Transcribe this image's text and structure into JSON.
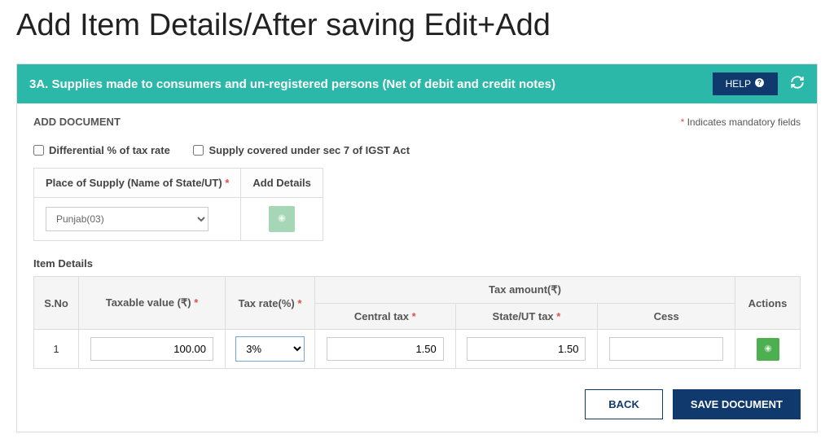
{
  "page": {
    "title": "Add Item Details/After saving Edit+Add"
  },
  "section": {
    "header": "3A. Supplies made to consumers and un-registered persons (Net of debit and credit notes)",
    "help_label": "HELP"
  },
  "doc": {
    "add_label": "ADD DOCUMENT",
    "mandatory_note": "Indicates mandatory fields",
    "checkbox1": "Differential % of tax rate",
    "checkbox2": "Supply covered under sec 7 of IGST Act",
    "pos_header": "Place of Supply (Name of State/UT)",
    "add_details_header": "Add Details",
    "pos_value": "Punjab(03)",
    "item_details_label": "Item Details"
  },
  "table": {
    "sno": "S.No",
    "taxable": "Taxable value (₹)",
    "taxrate": "Tax rate(%)",
    "taxamount": "Tax amount(₹)",
    "central": "Central tax",
    "stateut": "State/UT tax",
    "cess": "Cess",
    "actions": "Actions"
  },
  "row": {
    "sno": "1",
    "taxable": "100.00",
    "taxrate": "3%",
    "central": "1.50",
    "stateut": "1.50",
    "cess": ""
  },
  "buttons": {
    "back": "BACK",
    "save": "SAVE DOCUMENT"
  }
}
